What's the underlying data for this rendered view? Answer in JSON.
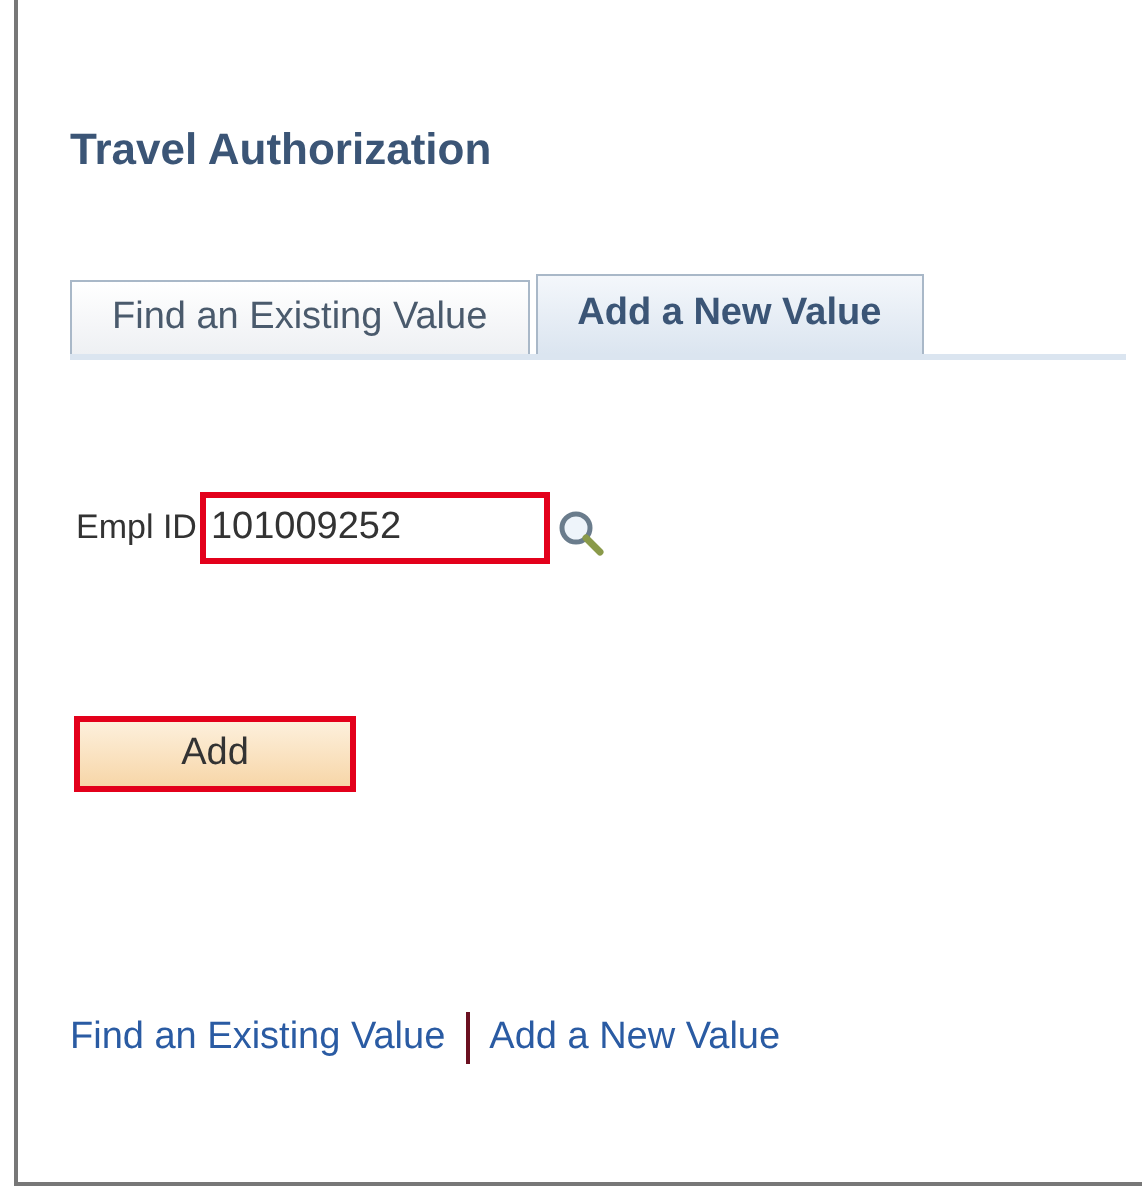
{
  "page": {
    "title": "Travel Authorization"
  },
  "tabs": [
    {
      "label": "Find an Existing Value",
      "selected": false
    },
    {
      "label": "Add a New Value",
      "selected": true
    }
  ],
  "empl_id": {
    "label": "Empl ID",
    "value": "101009252",
    "highlighted": true
  },
  "add_button": {
    "label": "Add",
    "highlighted": true
  },
  "links": [
    "Find an Existing Value",
    "Add a New Value"
  ]
}
